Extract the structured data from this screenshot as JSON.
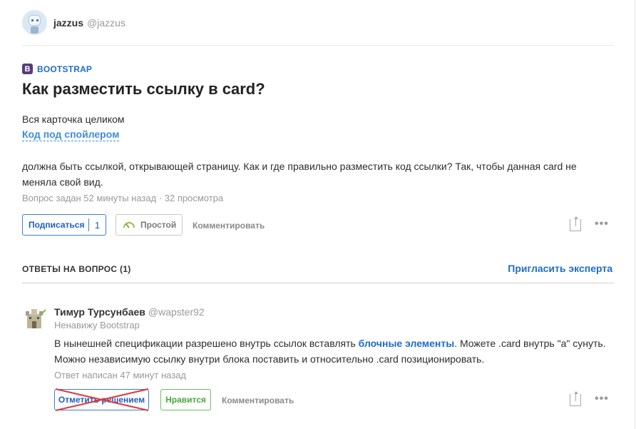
{
  "author": {
    "name": "jazzus",
    "nick": "@jazzus"
  },
  "tag": {
    "icon_letter": "B",
    "label": "BOOTSTRAP"
  },
  "question": {
    "title": "Как разместить ссылку в card?",
    "line1": "Вся карточка целиком",
    "spoiler": "Код под спойлером",
    "body": "должна быть ссылкой, открывающей страницу. Как и где правильно разместить код ссылки? Так, чтобы данная card не меняла свой вид.",
    "meta": "Вопрос задан 52 минуты назад · 32 просмотра"
  },
  "actions": {
    "subscribe_label": "Подписаться",
    "subscribe_count": "1",
    "difficulty_label": "Простой",
    "comment_label": "Комментировать",
    "share_icon": "share-icon",
    "more_icon": "more-icon",
    "more_glyph": "•••"
  },
  "answers": {
    "header": "ОТВЕТЫ НА ВОПРОС (1)",
    "invite_label": "Пригласить эксперта",
    "items": [
      {
        "name": "Тимур Турсунбаев",
        "nick": "@wapster92",
        "subtitle": "Ненавижу Bootstrap",
        "body_part1": "В нынешней спецификации разрешено внутрь ссылок вставлять ",
        "body_link": "блочные элементы",
        "body_part2": ". Можете .card внутрь \"a\" сунуть. Можно независимую ссылку внутри блока поставить и относительно .card позиционировать.",
        "meta": "Ответ написан 47 минут назад",
        "solve_label": "Отметить решением",
        "like_label": "Нравится",
        "comment_label": "Комментировать"
      }
    ]
  },
  "colors": {
    "accent": "#1e6cc8",
    "tag_bg": "#563d7c",
    "like": "#4aa63a",
    "cross": "#e0393e"
  }
}
